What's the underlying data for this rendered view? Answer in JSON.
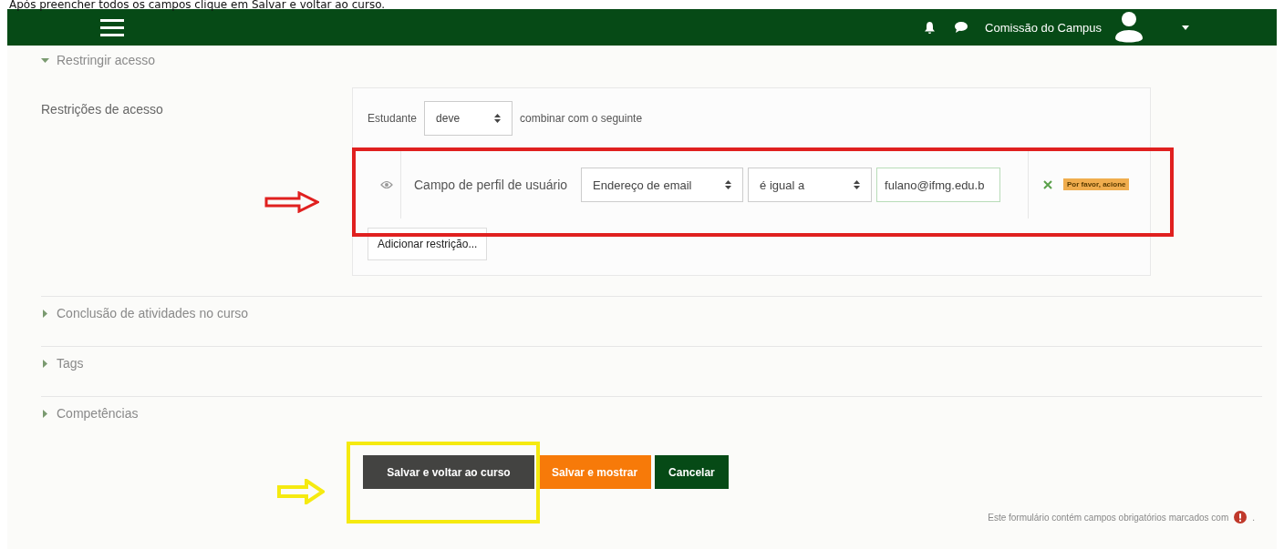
{
  "caption": "Após preencher todos os campos clique em Salvar e voltar ao curso.",
  "navbar": {
    "user_name": "Comissão do Campus"
  },
  "sections": [
    {
      "title": "Restringir acesso",
      "expanded": true,
      "restrictions": {
        "label": "Restrições de acesso",
        "student_label": "Estudante",
        "match_select": "deve",
        "match_suffix": "combinar com o seguinte",
        "conditions": [
          {
            "visible": true,
            "label": "Campo de perfil de usuário",
            "field_select": "Endereço de email",
            "operator_select": "é igual a",
            "value": "fulano@ifmg.edu.b",
            "badge": "Por favor, acione"
          }
        ],
        "add_button": "Adicionar restrição..."
      }
    },
    {
      "title": "Conclusão de atividades no curso",
      "expanded": false
    },
    {
      "title": "Tags",
      "expanded": false
    },
    {
      "title": "Competências",
      "expanded": false
    }
  ],
  "buttons": [
    {
      "label": "Salvar e voltar ao curso",
      "kind": "dark"
    },
    {
      "label": "Salvar e mostrar",
      "kind": "orange"
    },
    {
      "label": "Cancelar",
      "kind": "green"
    }
  ],
  "footer_note": "Este formulário contém campos obrigatórios marcados com",
  "footer_suffix": "."
}
